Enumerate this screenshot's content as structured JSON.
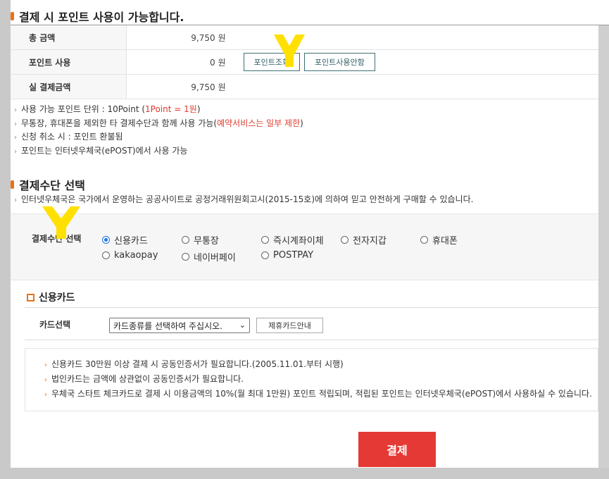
{
  "points_section": {
    "title": "결제 시 포인트 사용이 가능합니다.",
    "rows": [
      {
        "label": "총 금액",
        "amount": "9,750 원"
      },
      {
        "label": "포인트 사용",
        "amount": "0 원"
      },
      {
        "label": "실 결제금액",
        "amount": "9,750 원"
      }
    ],
    "buttons": {
      "inquiry": "포인트조회",
      "guide": "포인트사용안함"
    },
    "notes": {
      "line1_prefix": "사용 가능 포인트 단위 : 10Point (",
      "line1_red": "1Point = 1원",
      "line1_suffix": ")",
      "line2_prefix": "무통장, 휴대폰을 제외한 타 결제수단과 함께 사용 가능(",
      "line2_red": "예약서비스는 일부 제한",
      "line2_suffix": ")",
      "line3": "신청 취소 시 : 포인트 환불됨",
      "line4": "포인트는 인터넷우체국(ePOST)에서 사용 가능"
    }
  },
  "payment_section": {
    "title": "결제수단 선택",
    "note": "인터넷우체국은 국가에서 운영하는 공공사이트로 공정거래위원회고시(2015-15호)에 의하여 믿고 안전하게 구매할 수 있습니다.",
    "label": "결제수단 선택",
    "methods": [
      {
        "label": "신용카드",
        "checked": true
      },
      {
        "label": "무통장",
        "checked": false
      },
      {
        "label": "즉시계좌이체",
        "checked": false
      },
      {
        "label": "전자지갑",
        "checked": false
      },
      {
        "label": "휴대폰",
        "checked": false
      },
      {
        "label": "kakaopay",
        "checked": false
      },
      {
        "label": "네이버페이",
        "checked": false
      },
      {
        "label": "POSTPAY",
        "checked": false
      }
    ]
  },
  "credit_card": {
    "title": "신용카드",
    "select_label": "카드선택",
    "select_value": "카드종류를 선택하여 주십시오.",
    "partner_button": "제휴카드안내",
    "notes": [
      "신용카드 30만원 이상 결제 시 공동인증서가 필요합니다.(2005.11.01.부터 시행)",
      "법인카드는 금액에 상관없이 공동인증서가 필요합니다.",
      "우체국 스타트 체크카드로 결제 시 이용금액의 10%(월 최대 1만원) 포인트 적립되며, 적립된 포인트는 인터넷우체국(ePOST)에서 사용하실 수 있습니다."
    ]
  },
  "submit": {
    "label": "결제"
  },
  "colors": {
    "accent": "#e8731c",
    "red": "#e03a2c",
    "pay_button": "#e53935",
    "radio": "#1a73e8",
    "marker": "#ffe000"
  }
}
